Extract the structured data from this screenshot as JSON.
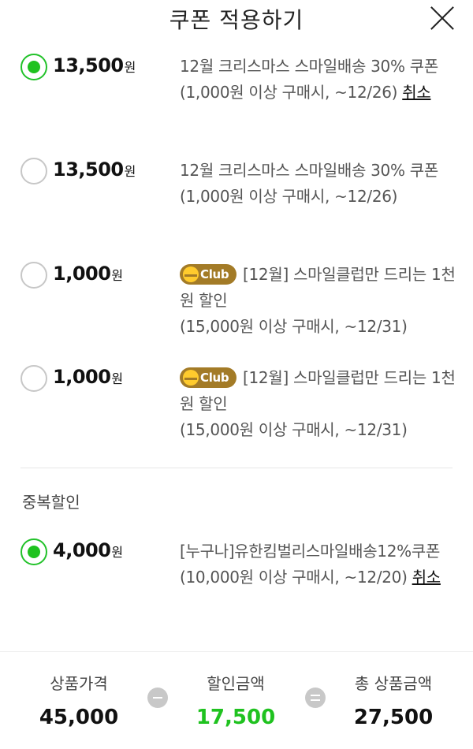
{
  "header": {
    "title": "쿠폰 적용하기"
  },
  "coupons": [
    {
      "amount": "13,500",
      "unit": "원",
      "title": "12월 크리스마스 스마일배송 30% 쿠폰",
      "condition": "(1,000원 이상 구매시, ~12/26)",
      "cancel_label": "취소",
      "selected": true
    },
    {
      "amount": "13,500",
      "unit": "원",
      "title": "12월 크리스마스 스마일배송 30% 쿠폰",
      "condition": "(1,000원 이상 구매시, ~12/26)",
      "selected": false
    },
    {
      "amount": "1,000",
      "unit": "원",
      "badge": "Club",
      "title": "[12월] 스마일클럽만 드리는 1천원 할인",
      "condition": "(15,000원 이상 구매시, ~12/31)",
      "selected": false
    },
    {
      "amount": "1,000",
      "unit": "원",
      "badge": "Club",
      "title": "[12월] 스마일클럽만 드리는 1천원 할인",
      "condition": "(15,000원 이상 구매시, ~12/31)",
      "selected": false
    }
  ],
  "duplicate_section": {
    "title": "중복할인",
    "coupon": {
      "amount": "4,000",
      "unit": "원",
      "title": "[누구나]유한킴벌리스마일배송12%쿠폰",
      "condition": "(10,000원 이상 구매시, ~12/20)",
      "cancel_label": "취소",
      "selected": true
    }
  },
  "summary": {
    "product_price_label": "상품가격",
    "product_price": "45,000",
    "discount_label": "할인금액",
    "discount": "17,500",
    "total_label": "총 상품금액",
    "total": "27,500"
  },
  "colors": {
    "accent_green": "#1fc21f",
    "club_badge": "#a37b27"
  },
  "icons": {
    "close": "close-icon",
    "minus": "minus-icon",
    "equals": "equals-icon",
    "club": "club-smile-icon"
  }
}
